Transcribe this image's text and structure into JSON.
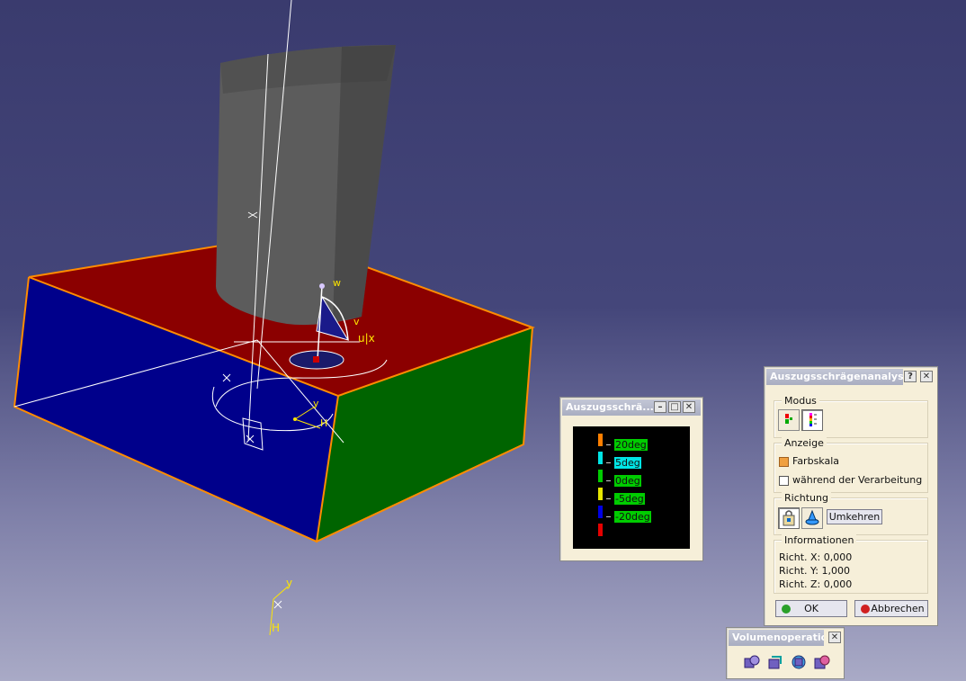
{
  "viewport": {
    "labels": {
      "w": "w",
      "v": "v",
      "ux": "u|x",
      "y1": "y",
      "h1": "H",
      "y2": "y",
      "h2": "H"
    }
  },
  "scale_window": {
    "title": "Auszugsschrä...",
    "legend": [
      {
        "color": "#ff7f00",
        "label": "20deg",
        "bg": "#00cc00"
      },
      {
        "color": "#00e5e5",
        "label": "5deg",
        "bg": "#00e5e5"
      },
      {
        "color": "#00cc00",
        "label": "0deg",
        "bg": "#00cc00"
      },
      {
        "color": "#e5e500",
        "label": "-5deg",
        "bg": "#00cc00"
      },
      {
        "color": "#0000e5",
        "label": "-20deg",
        "bg": "#00cc00"
      }
    ],
    "last_color": "#e50000"
  },
  "dialog": {
    "title": "Auszugsschrägenanalyse",
    "help_btn": "?",
    "close_btn": "✕",
    "modus": {
      "title": "Modus"
    },
    "anzeige": {
      "title": "Anzeige",
      "farbskala": "Farbskala",
      "farbskala_checked": true,
      "waehrend": "während der Verarbeitung",
      "waehrend_checked": false
    },
    "richtung": {
      "title": "Richtung",
      "umkehren": "Umkehren"
    },
    "informationen": {
      "title": "Informationen",
      "x": "Richt. X: 0,000",
      "y": "Richt. Y: 1,000",
      "z": "Richt. Z: 0,000"
    },
    "ok": "OK",
    "abbrechen": "Abbrechen"
  },
  "toolbar": {
    "title": "Volumenoperatio..."
  },
  "colors": {
    "face_top": "#8b0000",
    "face_front": "#00008b",
    "face_side": "#006400",
    "edge": "#ff8c00",
    "cylinder": "#5a5a5a"
  }
}
